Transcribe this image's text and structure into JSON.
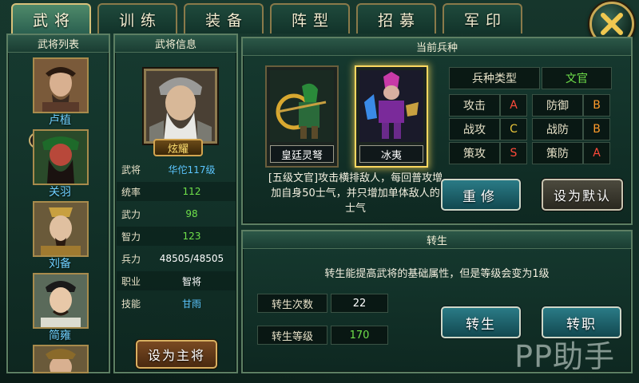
{
  "tabs": [
    {
      "label": "武将",
      "active": true
    },
    {
      "label": "训练",
      "active": false
    },
    {
      "label": "装备",
      "active": false
    },
    {
      "label": "阵型",
      "active": false
    },
    {
      "label": "招募",
      "active": false
    },
    {
      "label": "军印",
      "active": false
    }
  ],
  "general_list": {
    "title": "武将列表",
    "items": [
      {
        "name": "卢植"
      },
      {
        "name": "关羽",
        "badge": "主"
      },
      {
        "name": "刘备"
      },
      {
        "name": "简雍"
      }
    ]
  },
  "general_info": {
    "title": "武将信息",
    "title_badge": "炫耀",
    "stats": [
      {
        "key": "武将",
        "value": "华佗117级",
        "color": "blue"
      },
      {
        "key": "统率",
        "value": "112",
        "color": "green"
      },
      {
        "key": "武力",
        "value": "98",
        "color": "green"
      },
      {
        "key": "智力",
        "value": "123",
        "color": "green"
      },
      {
        "key": "兵力",
        "value": "48505/48505",
        "color": "white"
      },
      {
        "key": "职业",
        "value": "智将",
        "color": "white"
      },
      {
        "key": "技能",
        "value": "甘雨",
        "color": "blue"
      }
    ],
    "set_master_button": "设为主将"
  },
  "troop": {
    "title": "当前兵种",
    "units": [
      {
        "name": "皇廷灵弩",
        "selected": false
      },
      {
        "name": "冰夷",
        "selected": true
      }
    ],
    "description": "[五级文官]攻击横排敌人，每回普攻增加自身50士气，并只增加单体敌人的士气",
    "type_label": "兵种类型",
    "type_value": "文官",
    "grades": [
      {
        "k1": "攻击",
        "g1": "A",
        "k2": "防御",
        "g2": "B"
      },
      {
        "k1": "战攻",
        "g1": "C",
        "k2": "战防",
        "g2": "B"
      },
      {
        "k1": "策攻",
        "g1": "S",
        "k2": "策防",
        "g2": "A"
      }
    ],
    "rebuild_button": "重修",
    "set_default_button": "设为默认"
  },
  "rebirth": {
    "title": "转生",
    "description": "转生能提高武将的基础属性，但是等级会变为1级",
    "count_label": "转生次数",
    "count_value": "22",
    "level_label": "转生等级",
    "level_value": "170",
    "rebirth_button": "转生",
    "change_job_button": "转职"
  },
  "watermark": "PP助手",
  "colors": {
    "accent_gold": "#d8c27a",
    "stat_blue": "#5cc6ff",
    "stat_green": "#6fe04a",
    "grade_red": "#ff4a3a",
    "grade_orange": "#ff9a2a",
    "type_green": "#6fe04a"
  }
}
